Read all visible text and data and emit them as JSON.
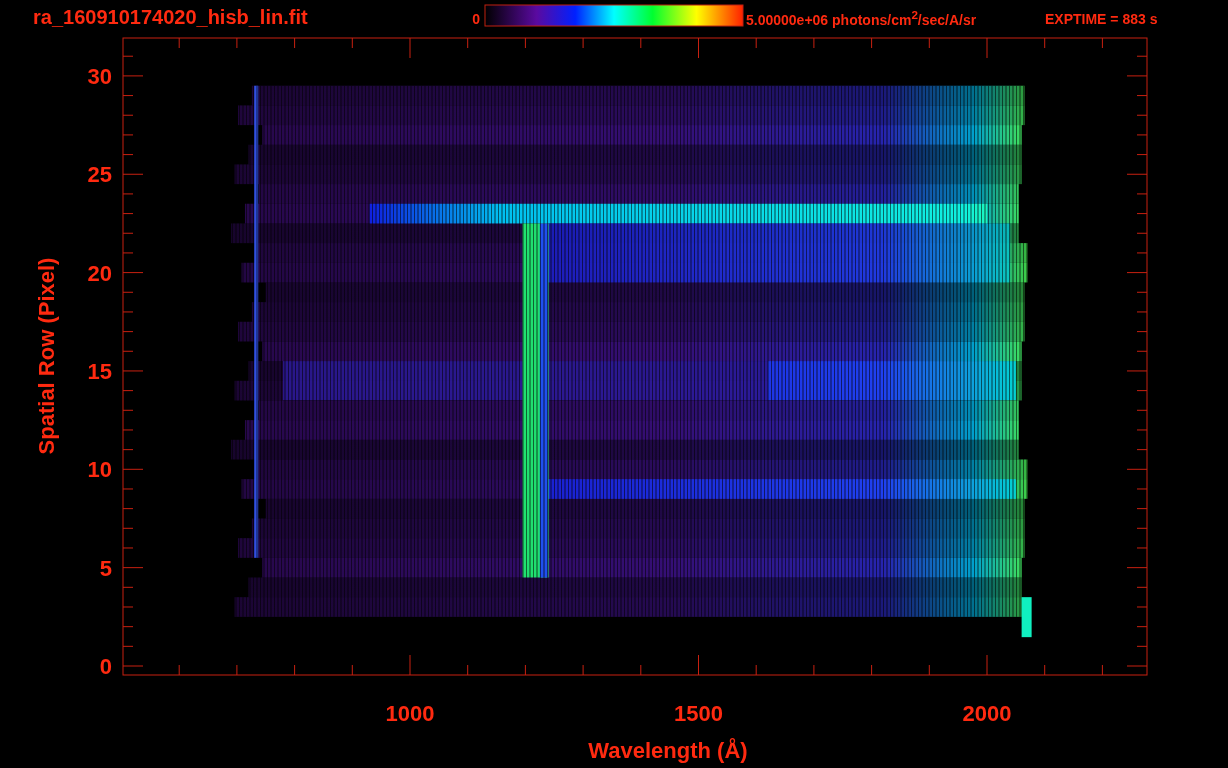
{
  "plot": {
    "title": "ra_160910174020_hisb_lin.fit",
    "colorbar": {
      "min_label": "0",
      "max_label": "5.00000e+06 photons/cm$^{2}$/sec/A/sr"
    },
    "exposure": "EXPTIME = 883 s",
    "xlabel": "Wavelength (Å)",
    "ylabel": "Spatial Row (Pixel)",
    "xticks": [
      "1000",
      "1500",
      "2000"
    ],
    "yticks": [
      "30",
      "25",
      "20",
      "15",
      "10",
      "5",
      "0"
    ]
  }
}
